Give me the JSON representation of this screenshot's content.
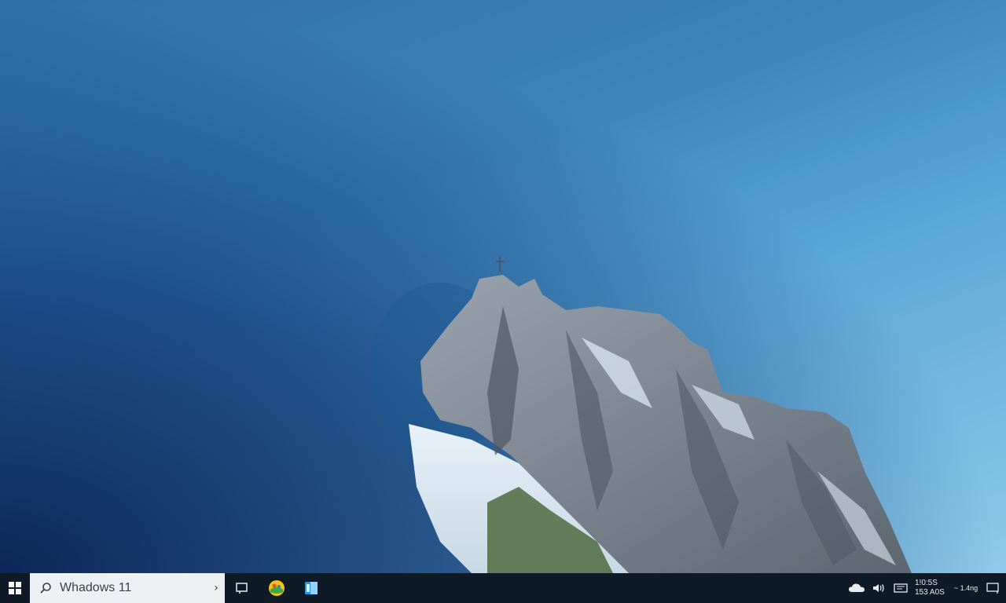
{
  "taskbar": {
    "search": {
      "text": "Whadows 11",
      "chevron": "›"
    },
    "icons": [
      {
        "name": "start-windows-icon"
      },
      {
        "name": "search-icon"
      },
      {
        "name": "task-view-icon"
      },
      {
        "name": "colorful-app-icon"
      },
      {
        "name": "file-explorer-icon"
      }
    ],
    "tray": {
      "cloud_icon": "cloud-icon",
      "volume_icon": "volume-icon",
      "network_icon": "network-icon",
      "clock_time": "1!0:5S",
      "clock_date": "153 A0S",
      "lang_text": "~ 1.4ng",
      "notification_icon": "notification-icon"
    }
  },
  "colors": {
    "taskbar_bg": "#0f1a27",
    "search_bg": "#eef1f4",
    "sky_top": "#2f6fa7",
    "sky_light": "#8fcaea",
    "sky_dark": "#082050"
  }
}
